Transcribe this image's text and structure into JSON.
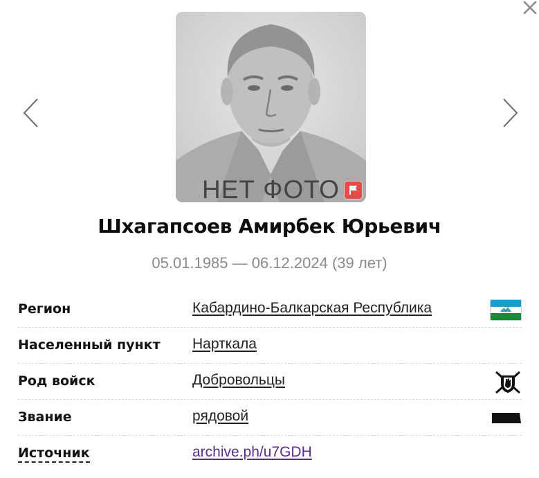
{
  "photo": {
    "caption": "НЕТ ФОТО"
  },
  "person": {
    "name": "Шхагапсоев Амирбек Юрьевич",
    "dates": "05.01.1985 — 06.12.2024 (39 лет)"
  },
  "rows": [
    {
      "label": "Регион",
      "value": "Кабардино-Балкарская Республика",
      "icon": "kbr-flag-icon"
    },
    {
      "label": "Населенный пункт",
      "value": "Нарткала"
    },
    {
      "label": "Род войск",
      "value": "Добровольцы",
      "icon": "volunteers-emblem-icon"
    },
    {
      "label": "Звание",
      "value": "рядовой",
      "icon": "rank-insignia-icon"
    },
    {
      "label": "Источник",
      "value": "archive.ph/u7GDH"
    }
  ],
  "colors": {
    "link": "#5b2c8f",
    "flag_report": "#e24c4b",
    "flag_kbr_blue": "#1e9ad6",
    "flag_kbr_green": "#1a8a3a",
    "dates_gray": "#8a8a8a"
  }
}
